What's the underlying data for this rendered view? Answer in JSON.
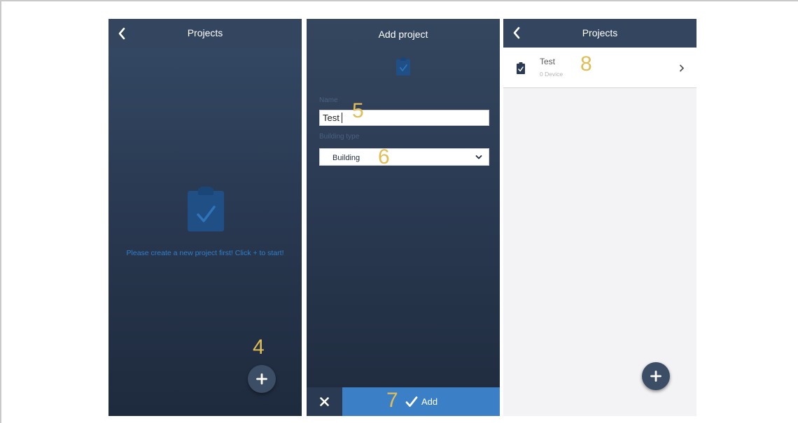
{
  "screens": {
    "projects_empty": {
      "title": "Projects",
      "empty_message": "Please create a new project first! Click + to start!",
      "step_label": "4"
    },
    "add_project": {
      "title": "Add project",
      "name_label": "Name",
      "name_value": "Test",
      "name_step": "5",
      "building_type_label": "Building type",
      "building_type_value": "Building",
      "building_type_step": "6",
      "add_step": "7",
      "add_label": "Add"
    },
    "projects_list": {
      "title": "Projects",
      "items": [
        {
          "name": "Test",
          "subtitle": "0 Device",
          "step": "8"
        }
      ]
    }
  },
  "icons": [
    "back-chevron-icon",
    "clipboard-check-icon",
    "plus-icon",
    "chevron-down-icon",
    "close-icon",
    "check-icon",
    "chevron-right-icon"
  ],
  "colors": {
    "header": "#34465f",
    "accent_blue": "#3b7fc6",
    "step_number": "#e1bd56",
    "empty_message": "#2f7fcc",
    "list_background": "#f3f3f5"
  }
}
